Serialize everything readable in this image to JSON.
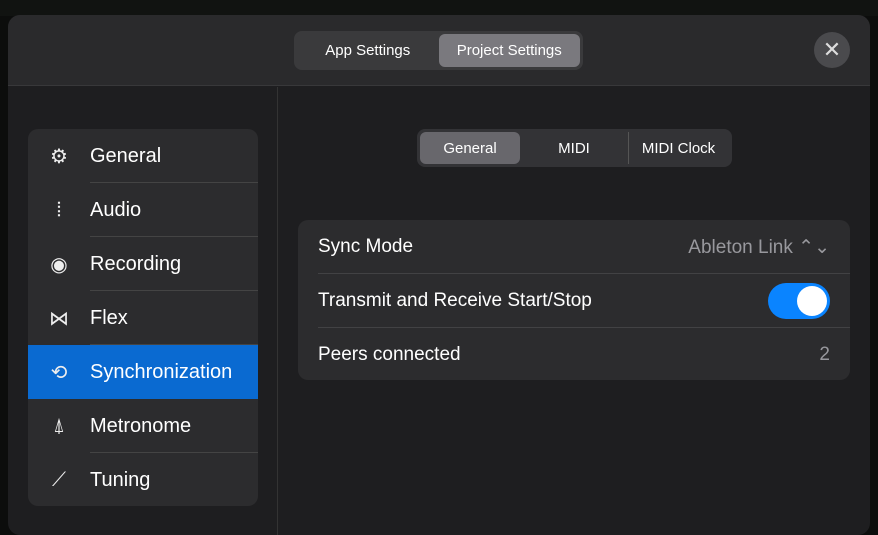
{
  "header": {
    "tabs": [
      {
        "label": "App Settings"
      },
      {
        "label": "Project Settings"
      }
    ],
    "close": "✕"
  },
  "sidebar": {
    "items": [
      {
        "label": "General",
        "icon": "⚙"
      },
      {
        "label": "Audio",
        "icon": "⦙"
      },
      {
        "label": "Recording",
        "icon": "◉"
      },
      {
        "label": "Flex",
        "icon": "⋈"
      },
      {
        "label": "Synchronization",
        "icon": "⟲"
      },
      {
        "label": "Metronome",
        "icon": "⍋"
      },
      {
        "label": "Tuning",
        "icon": "⟋"
      }
    ]
  },
  "main": {
    "tabs": [
      {
        "label": "General"
      },
      {
        "label": "MIDI"
      },
      {
        "label": "MIDI Clock"
      }
    ],
    "rows": [
      {
        "label": "Sync Mode",
        "value": "Ableton Link ⌃⌄"
      },
      {
        "label": "Transmit and Receive Start/Stop",
        "value": true
      },
      {
        "label": "Peers connected",
        "value": "2"
      }
    ]
  },
  "colors": {
    "accent": "#0a6ad1",
    "toggle": "#0a84ff"
  }
}
